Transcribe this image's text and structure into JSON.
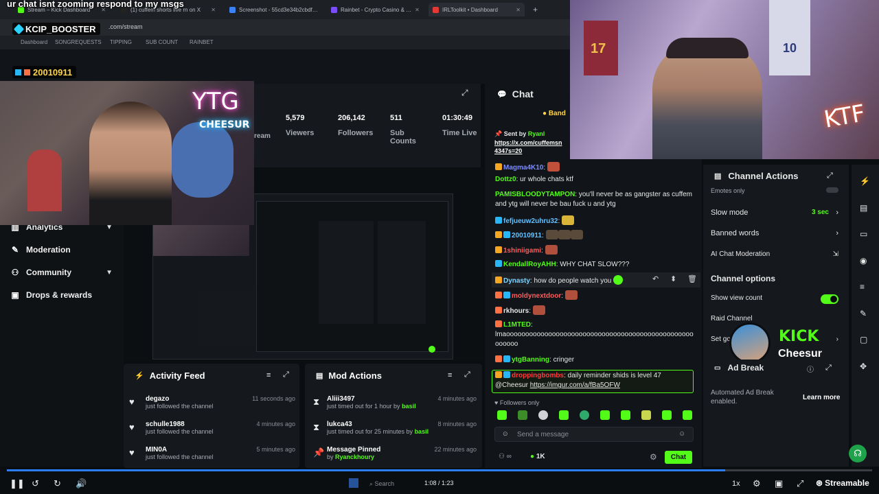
{
  "overlay": {
    "message": "ur chat isnt zooming respond to my msgs",
    "booster": "KCIP_BOOSTER",
    "number_badge": "20010911"
  },
  "browser": {
    "tabs": [
      "Stream – Kick Dashboard",
      "(1) cuffem shorts live rn on X",
      "Screenshot - 55cd3e34b2cbdf…",
      "Rainbet - Crypto Casino & …",
      "IRLToolkit • Dashboard"
    ],
    "address": ".com/stream",
    "bookmarks": [
      "Dashboard",
      "SONGREQUESTS",
      "TIPPING",
      "SUB COUNT",
      "RAINBET"
    ]
  },
  "webcam": {
    "left_sign": "YTG",
    "left_sign_sub": "CHEESUR",
    "right_sign": "KTF",
    "right_numbers": [
      "17",
      "10"
    ]
  },
  "stats": {
    "stream_label": "ream",
    "viewers_value": "5,579",
    "viewers_label": "Viewers",
    "followers_value": "206,142",
    "followers_label": "Followers",
    "subs_value": "511",
    "subs_label": "Sub Counts",
    "time_value": "01:30:49",
    "time_label": "Time Live"
  },
  "sidebar": {
    "items": [
      {
        "label": "Analytics",
        "icon": "analytics-icon"
      },
      {
        "label": "Moderation",
        "icon": "wrench-icon"
      },
      {
        "label": "Community",
        "icon": "community-icon"
      },
      {
        "label": "Drops & rewards",
        "icon": "gift-icon"
      }
    ]
  },
  "activity_feed": {
    "title": "Activity Feed",
    "items": [
      {
        "name": "degazo",
        "desc": "just followed the channel",
        "time": "11 seconds ago"
      },
      {
        "name": "schulle1988",
        "desc": "just followed the channel",
        "time": "4 minutes ago"
      },
      {
        "name": "MIN0A",
        "desc": "just followed the channel",
        "time": "5 minutes ago"
      }
    ]
  },
  "mod_actions": {
    "title": "Mod Actions",
    "items": [
      {
        "name": "Aliii3497",
        "desc_prefix": "just timed out for 1 hour by ",
        "by": "basil",
        "time": "4 minutes ago"
      },
      {
        "name": "lukca43",
        "desc_prefix": "just timed out for 25 minutes by ",
        "by": "basil",
        "time": "8 minutes ago"
      },
      {
        "name": "Message Pinned",
        "desc_prefix": "by ",
        "by": "Ryanckhoury",
        "time": "22 minutes ago"
      }
    ]
  },
  "chat": {
    "title": "Chat",
    "banner": "Band",
    "sent_by_label": "Sent by",
    "sent_by_user": "Ryanl",
    "link": "https://x.com/cuffemsn",
    "link2": "4347s=20",
    "messages": [
      {
        "user": "Magma4K10",
        "text": "",
        "color": "#7b8cff"
      },
      {
        "user": "Dottz0",
        "text": "ur whole chats ktf",
        "color": "#53fc18"
      },
      {
        "user": "PAMISBLOODYTAMPON",
        "text": "you'll never be as gangster as cuffem and ytg will never be bau fuck u and ytg",
        "color": "#53fc18"
      },
      {
        "user": "fefjueuw2uhru32",
        "text": "",
        "color": "#66c2ff"
      },
      {
        "user": "20010911",
        "text": "",
        "color": "#66c2ff"
      },
      {
        "user": "1shiniigami",
        "text": "",
        "color": "#ff5c5c"
      },
      {
        "user": "KendallRoyAHH",
        "text": "WHY CHAT SLOW???",
        "color": "#53fc18"
      },
      {
        "user": "Dynasty",
        "text": "how do people watch you",
        "color": "#7fd4ff"
      },
      {
        "user": "moldynextdoor",
        "text": "",
        "color": "#ff5c5c"
      },
      {
        "user": "rkhours",
        "text": "",
        "color": "#e8e8e8"
      },
      {
        "user": "L1MTED",
        "text": "lmaooooooooooooooooooooooooooooooooooooooooooooooooooooooo",
        "color": "#53fc18"
      },
      {
        "user": "ytgBanning",
        "text": "cringer",
        "color": "#53fc18"
      },
      {
        "user": "droppingbombs",
        "text": "daily reminder shids is level 47",
        "color": "#ff3b3b"
      }
    ],
    "pinned_mention": "@Cheesur",
    "pinned_link": "https://imgur.com/a/fBa5OFW",
    "followers_only": "Followers only",
    "send_placeholder": "Send a message",
    "viewer_count": "1K",
    "chat_button": "Chat"
  },
  "channel_actions": {
    "title": "Channel Actions",
    "partial_row": "Emotes only",
    "slow_mode_label": "Slow mode",
    "slow_mode_value": "3 sec",
    "banned_words": "Banned words",
    "ai_moderation": "AI Chat Moderation",
    "options_title": "Channel options",
    "show_view_count": "Show view count",
    "show_view_count_on": true,
    "raid_channel": "Raid Channel",
    "set_goal": "Set go"
  },
  "kick_overlay": {
    "brand": "KICK",
    "name": "Cheesur"
  },
  "ad_break": {
    "title": "Ad Break",
    "desc": "Automated Ad Break enabled.",
    "learn_more": "Learn more"
  },
  "player": {
    "time": "1:08 / 1:23",
    "search": "Search",
    "speed": "1x",
    "brand": "Streamable",
    "progress": 0.83
  },
  "colors": {
    "kick_green": "#53fc18",
    "panel": "#15181d",
    "background": "#0b0e11",
    "progress": "#2b7fff"
  }
}
